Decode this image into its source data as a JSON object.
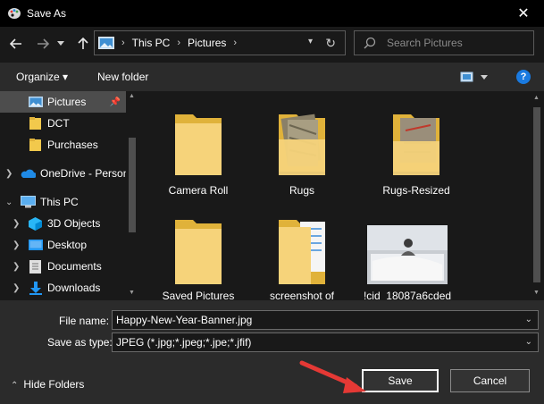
{
  "window": {
    "title": "Save As",
    "close_glyph": "✕"
  },
  "nav": {
    "breadcrumb": [
      "This PC",
      "Pictures"
    ],
    "search_placeholder": "Search Pictures"
  },
  "toolbar": {
    "organize": "Organize ▾",
    "new_folder": "New folder",
    "help": "?"
  },
  "sidebar": {
    "items": [
      {
        "label": "Pictures",
        "icon": "pictures-icon"
      },
      {
        "label": "DCT",
        "icon": "folder-icon"
      },
      {
        "label": "Purchases",
        "icon": "folder-icon"
      },
      {
        "label": "OneDrive - Person",
        "icon": "onedrive-icon"
      },
      {
        "label": "This PC",
        "icon": "computer-icon"
      },
      {
        "label": "3D Objects",
        "icon": "3d-objects-icon"
      },
      {
        "label": "Desktop",
        "icon": "desktop-icon"
      },
      {
        "label": "Documents",
        "icon": "documents-icon"
      },
      {
        "label": "Downloads",
        "icon": "downloads-icon"
      }
    ]
  },
  "files": [
    {
      "label": "Camera Roll",
      "kind": "folder"
    },
    {
      "label": "Rugs",
      "kind": "folder-with-images"
    },
    {
      "label": "Rugs-Resized",
      "kind": "folder-with-images"
    },
    {
      "label": "Saved Pictures",
      "kind": "folder"
    },
    {
      "label": "screenshot of",
      "kind": "folder-with-documents"
    },
    {
      "label": "!cid_18087a6cded",
      "kind": "image"
    }
  ],
  "form": {
    "file_name_label": "File name:",
    "file_name_value": "Happy-New-Year-Banner.jpg",
    "save_type_label": "Save as type:",
    "save_type_value": "JPEG (*.jpg;*.jpeg;*.jpe;*.jfif)",
    "hide_folders": "Hide Folders",
    "save_button": "Save",
    "cancel_button": "Cancel"
  },
  "colors": {
    "accent": "#1a7ae0",
    "annotation_arrow": "#e53935",
    "folder": "#f2c94c"
  }
}
